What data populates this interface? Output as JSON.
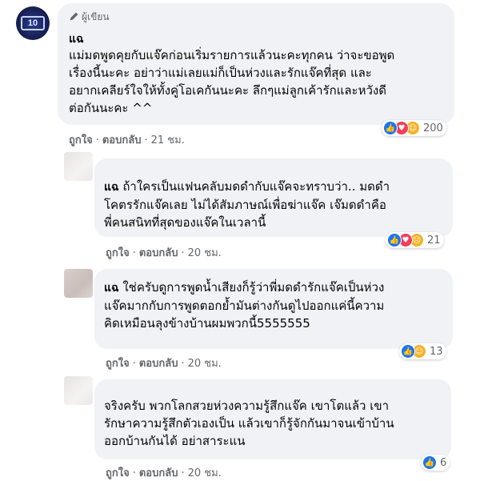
{
  "comments": [
    {
      "badge": "ผู้เขียน",
      "author": "แฉ",
      "lines": [
        "แม่มดพูดคุยกับแจ๊คก่อนเริ่มรายการแล้วนะคะทุกคน ว่าจะขอพูด",
        "เรื่องนี้นะคะ อย่าว่าแม่เลยแม่ก็เป็นห่วงและรักแจ๊คที่สุด และ",
        "อยากเคลียร์ใจให้ทั้งคู่โอเคกันนะคะ ลึกๆแม่ลูกเค้ารักและหวังดี",
        "ต่อกันนะคะ ^^"
      ],
      "reactions": [
        "like-icon",
        "love-icon",
        "care-icon"
      ],
      "reaction_count": "200",
      "like_label": "ถูกใจ",
      "reply_label": "ตอบกลับ",
      "time": "21 ชม."
    },
    {
      "author": "แฉ",
      "lines": [
        "ถ้าใครเป็นแฟนคลับมดดำกับแจ๊คจะทราบว่า.. มดดำ",
        "โคตรรักแจ๊คเลย ไม่ได้สัมภาษณ์เพื่อฆ่าแจ๊ค เจ๊มดดำคือ",
        "พี่คนสนิทที่สุดของแจ๊คในเวลานี้"
      ],
      "reactions": [
        "like-icon",
        "love-icon",
        "sad-icon"
      ],
      "reaction_count": "21",
      "like_label": "ถูกใจ",
      "reply_label": "ตอบกลับ",
      "time": "20 ชม."
    },
    {
      "author": "แฉ",
      "lines": [
        "ใช่ครับดูการพูดน้ำเสียงก็รู้ว่าพี่มดดำรักแจ๊คเป็นห่วง",
        "แจ๊คมากกับการพูดตอกย้ำมันต่างกันดูไปออกแค่นี้ความ",
        "คิดเหมือนลุงข้างบ้านผมพวกนี้5555555"
      ],
      "reactions": [
        "like-icon",
        "care-icon"
      ],
      "reaction_count": "13",
      "like_label": "ถูกใจ",
      "reply_label": "ตอบกลับ",
      "time": "20 ชม."
    },
    {
      "lines": [
        "จริงครับ พวกโลกสวยห่วงความรู้สึกแจ๊ค เขาโตแล้ว เขา",
        "รักษาความรู้สึกตัวเองเป็น แล้วเขาก็รู้จักกันมาจนเข้าบ้าน",
        "ออกบ้านกันได้ อย่าสาระแน"
      ],
      "reactions": [
        "like-icon"
      ],
      "reaction_count": "6",
      "like_label": "ถูกใจ",
      "reply_label": "ตอบกลับ",
      "time": "20 ชม."
    }
  ],
  "colors": {
    "bubble": "#f0f2f5",
    "secondary_text": "#65676b",
    "like_blue": "#1877f2",
    "love_red": "#f33e58",
    "care_yellow": "#f7b125"
  }
}
